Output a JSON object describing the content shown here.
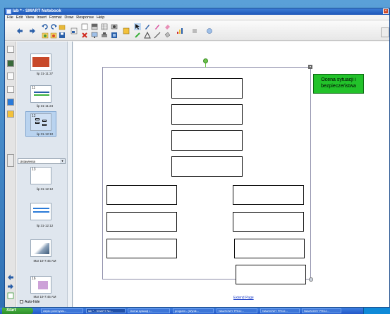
{
  "window": {
    "title": "lab * - SMART Notebook",
    "menu": [
      "File",
      "Edit",
      "View",
      "Insert",
      "Format",
      "Draw",
      "Response",
      "Help"
    ]
  },
  "toolbar": {
    "icons": [
      "back-icon",
      "forward-icon",
      "undo-icon",
      "redo-icon",
      "add-page-icon",
      "delete-icon",
      "screen-shade-icon",
      "fullscreen-icon",
      "select-icon",
      "pen-icon",
      "eraser-icon",
      "line-icon",
      "shape-icon",
      "text-icon",
      "fill-icon",
      "table-icon",
      "properties-icon"
    ]
  },
  "sorter": {
    "pages": [
      {
        "num": "",
        "label": "lip 31-11:37",
        "selected": false
      },
      {
        "num": "11",
        "label": "lip 31-11:24",
        "selected": false
      },
      {
        "num": "12",
        "label": "lip 31-12:10",
        "selected": true
      },
      {
        "num": "13",
        "label": "lip 31-12:12",
        "selected": false
      },
      {
        "num": "",
        "label": "lip 31-12:12",
        "selected": false
      },
      {
        "num": "",
        "label": "Mar 19-7:45 AM",
        "selected": false
      },
      {
        "num": "16",
        "label": "Mar 19-7:45 AM",
        "selected": false
      }
    ],
    "dropdown": "Ustawienia",
    "auto_hide": "Auto-hide"
  },
  "canvas": {
    "green_label": "Ocena sytuacji i bezpieczeństwa",
    "extend_page": "Extend Page"
  },
  "taskbar": {
    "start": "Start",
    "tasks": [
      "ciepło przemysłu...",
      "lab * - SMART No...",
      "Ocena sytuacji i...",
      "program - (Wynik...",
      "NAUKOWY PROJ...",
      "NAUKOWY PROJ...",
      "NAUKOWY PROJ..."
    ]
  }
}
